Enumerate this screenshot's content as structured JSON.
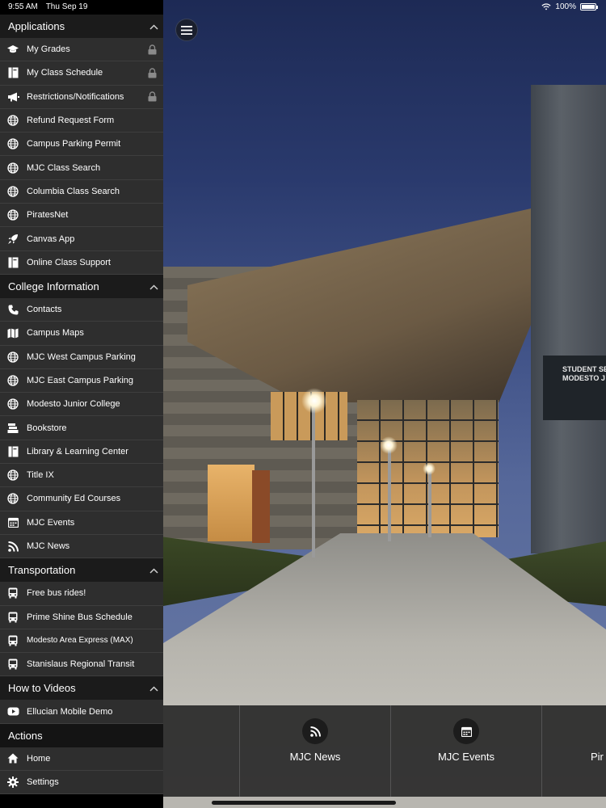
{
  "status_bar": {
    "time": "9:55 AM",
    "date": "Thu Sep 19",
    "battery": "100%",
    "battery_level": 1.0
  },
  "sidebar": {
    "sections": [
      {
        "title": "Applications",
        "collapsible": true,
        "items": [
          {
            "label": "My Grades",
            "icon": "graduation-cap-icon",
            "locked": true
          },
          {
            "label": "My Class Schedule",
            "icon": "book-icon",
            "locked": true
          },
          {
            "label": "Restrictions/Notifications",
            "icon": "megaphone-icon",
            "locked": true
          },
          {
            "label": "Refund Request Form",
            "icon": "globe-icon",
            "locked": false
          },
          {
            "label": "Campus Parking Permit",
            "icon": "globe-icon",
            "locked": false
          },
          {
            "label": "MJC Class Search",
            "icon": "globe-icon",
            "locked": false
          },
          {
            "label": "Columbia Class Search",
            "icon": "globe-icon",
            "locked": false
          },
          {
            "label": "PiratesNet",
            "icon": "globe-icon",
            "locked": false
          },
          {
            "label": "Canvas App",
            "icon": "rocket-icon",
            "locked": false
          },
          {
            "label": "Online Class Support",
            "icon": "book-icon",
            "locked": false
          }
        ]
      },
      {
        "title": "College Information",
        "collapsible": true,
        "items": [
          {
            "label": "Contacts",
            "icon": "phone-icon",
            "locked": false
          },
          {
            "label": "Campus Maps",
            "icon": "map-icon",
            "locked": false
          },
          {
            "label": "MJC West Campus Parking",
            "icon": "globe-icon",
            "locked": false
          },
          {
            "label": "MJC East Campus Parking",
            "icon": "globe-icon",
            "locked": false
          },
          {
            "label": "Modesto Junior College",
            "icon": "globe-icon",
            "locked": false
          },
          {
            "label": "Bookstore",
            "icon": "bookstore-icon",
            "locked": false
          },
          {
            "label": "Library & Learning Center",
            "icon": "book-icon",
            "locked": false
          },
          {
            "label": "Title IX",
            "icon": "globe-icon",
            "locked": false
          },
          {
            "label": "Community Ed Courses",
            "icon": "globe-icon",
            "locked": false
          },
          {
            "label": "MJC Events",
            "icon": "calendar-icon",
            "locked": false
          },
          {
            "label": "MJC News",
            "icon": "rss-icon",
            "locked": false
          }
        ]
      },
      {
        "title": "Transportation",
        "collapsible": true,
        "items": [
          {
            "label": "Free bus rides!",
            "icon": "bus-icon",
            "locked": false
          },
          {
            "label": "Prime Shine Bus Schedule",
            "icon": "bus-icon",
            "locked": false
          },
          {
            "label": "Modesto Area Express (MAX)",
            "icon": "bus-icon",
            "locked": false,
            "small": true
          },
          {
            "label": "Stanislaus Regional Transit",
            "icon": "bus-icon",
            "locked": false
          }
        ]
      },
      {
        "title": "How to Videos",
        "collapsible": true,
        "items": [
          {
            "label": "Ellucian Mobile Demo",
            "icon": "youtube-icon",
            "locked": false
          }
        ]
      },
      {
        "title": "Actions",
        "collapsible": false,
        "items": [
          {
            "label": "Home",
            "icon": "home-icon",
            "locked": false
          },
          {
            "label": "Settings",
            "icon": "gear-icon",
            "locked": false
          }
        ]
      }
    ]
  },
  "background": {
    "sign_line1": "STUDENT SE",
    "sign_line2": "MODESTO J"
  },
  "tiles": [
    {
      "label": "",
      "icon": ""
    },
    {
      "label": "MJC News",
      "icon": "rss-icon"
    },
    {
      "label": "MJC Events",
      "icon": "calendar-icon"
    },
    {
      "label": "Pir",
      "icon": ""
    }
  ],
  "colors": {
    "sidebar_bg": "#000000",
    "section_header": "#1b1b1b",
    "item_bg": "#2e2e2e",
    "tile_bar": "#2a2a2a"
  }
}
